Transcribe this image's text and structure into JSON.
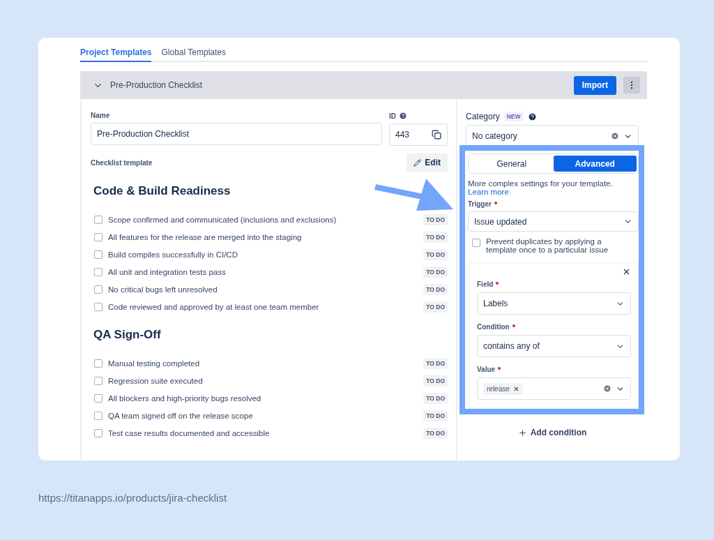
{
  "tabs": [
    {
      "label": "Project Templates",
      "selected": true
    },
    {
      "label": "Global Templates",
      "selected": false
    }
  ],
  "template": {
    "title": "Pre-Production Checklist",
    "expanded": true,
    "import_button": "Import",
    "name_label": "Name",
    "name_value": "Pre-Production Checklist",
    "id_label": "ID",
    "id_value": "443",
    "checklist_label": "Checklist template",
    "edit_button": "Edit"
  },
  "sections": [
    {
      "heading": "Code & Build Readiness",
      "items": [
        {
          "text": "Scope confirmed and communicated (inclusions and exclusions)",
          "checked": false,
          "status": "TO DO"
        },
        {
          "text": "All features for the release are merged into the staging",
          "checked": false,
          "status": "TO DO"
        },
        {
          "text": "Build compiles successfully in CI/CD",
          "checked": false,
          "status": "TO DO"
        },
        {
          "text": "All unit and integration tests pass",
          "checked": false,
          "status": "TO DO"
        },
        {
          "text": "No critical bugs left unresolved",
          "checked": false,
          "status": "TO DO"
        },
        {
          "text": "Code reviewed and approved by at least one team member",
          "checked": false,
          "status": "TO DO"
        }
      ]
    },
    {
      "heading": "QA Sign-Off",
      "items": [
        {
          "text": "Manual testing completed",
          "checked": false,
          "status": "TO DO"
        },
        {
          "text": "Regression suite executed",
          "checked": false,
          "status": "TO DO"
        },
        {
          "text": "All blockers and high-priority bugs resolved",
          "checked": false,
          "status": "TO DO"
        },
        {
          "text": "QA team signed off on the release scope",
          "checked": false,
          "status": "TO DO"
        },
        {
          "text": "Test case results documented and accessible",
          "checked": false,
          "status": "TO DO"
        }
      ]
    }
  ],
  "settings": {
    "category_label": "Category",
    "category_badge": "NEW",
    "category_value": "No category",
    "modes": [
      {
        "label": "General",
        "selected": false
      },
      {
        "label": "Advanced",
        "selected": true
      }
    ],
    "description": "More complex settings for your template.",
    "learn_more": "Learn more",
    "trigger_label": "Trigger",
    "trigger_required": true,
    "trigger_value": "Issue updated",
    "prevent_duplicates": {
      "label": "Prevent duplicates by applying a template once to a particular issue",
      "checked": false
    },
    "condition": {
      "field_label": "Field",
      "field_required": true,
      "field_value": "Labels",
      "condition_label": "Condition",
      "condition_required": true,
      "condition_value": "contains any of",
      "value_label": "Value",
      "value_required": true,
      "value_tags": [
        "release"
      ]
    },
    "add_condition": "Add condition"
  },
  "source_url": "https://titanapps.io/products/jira-checklist"
}
